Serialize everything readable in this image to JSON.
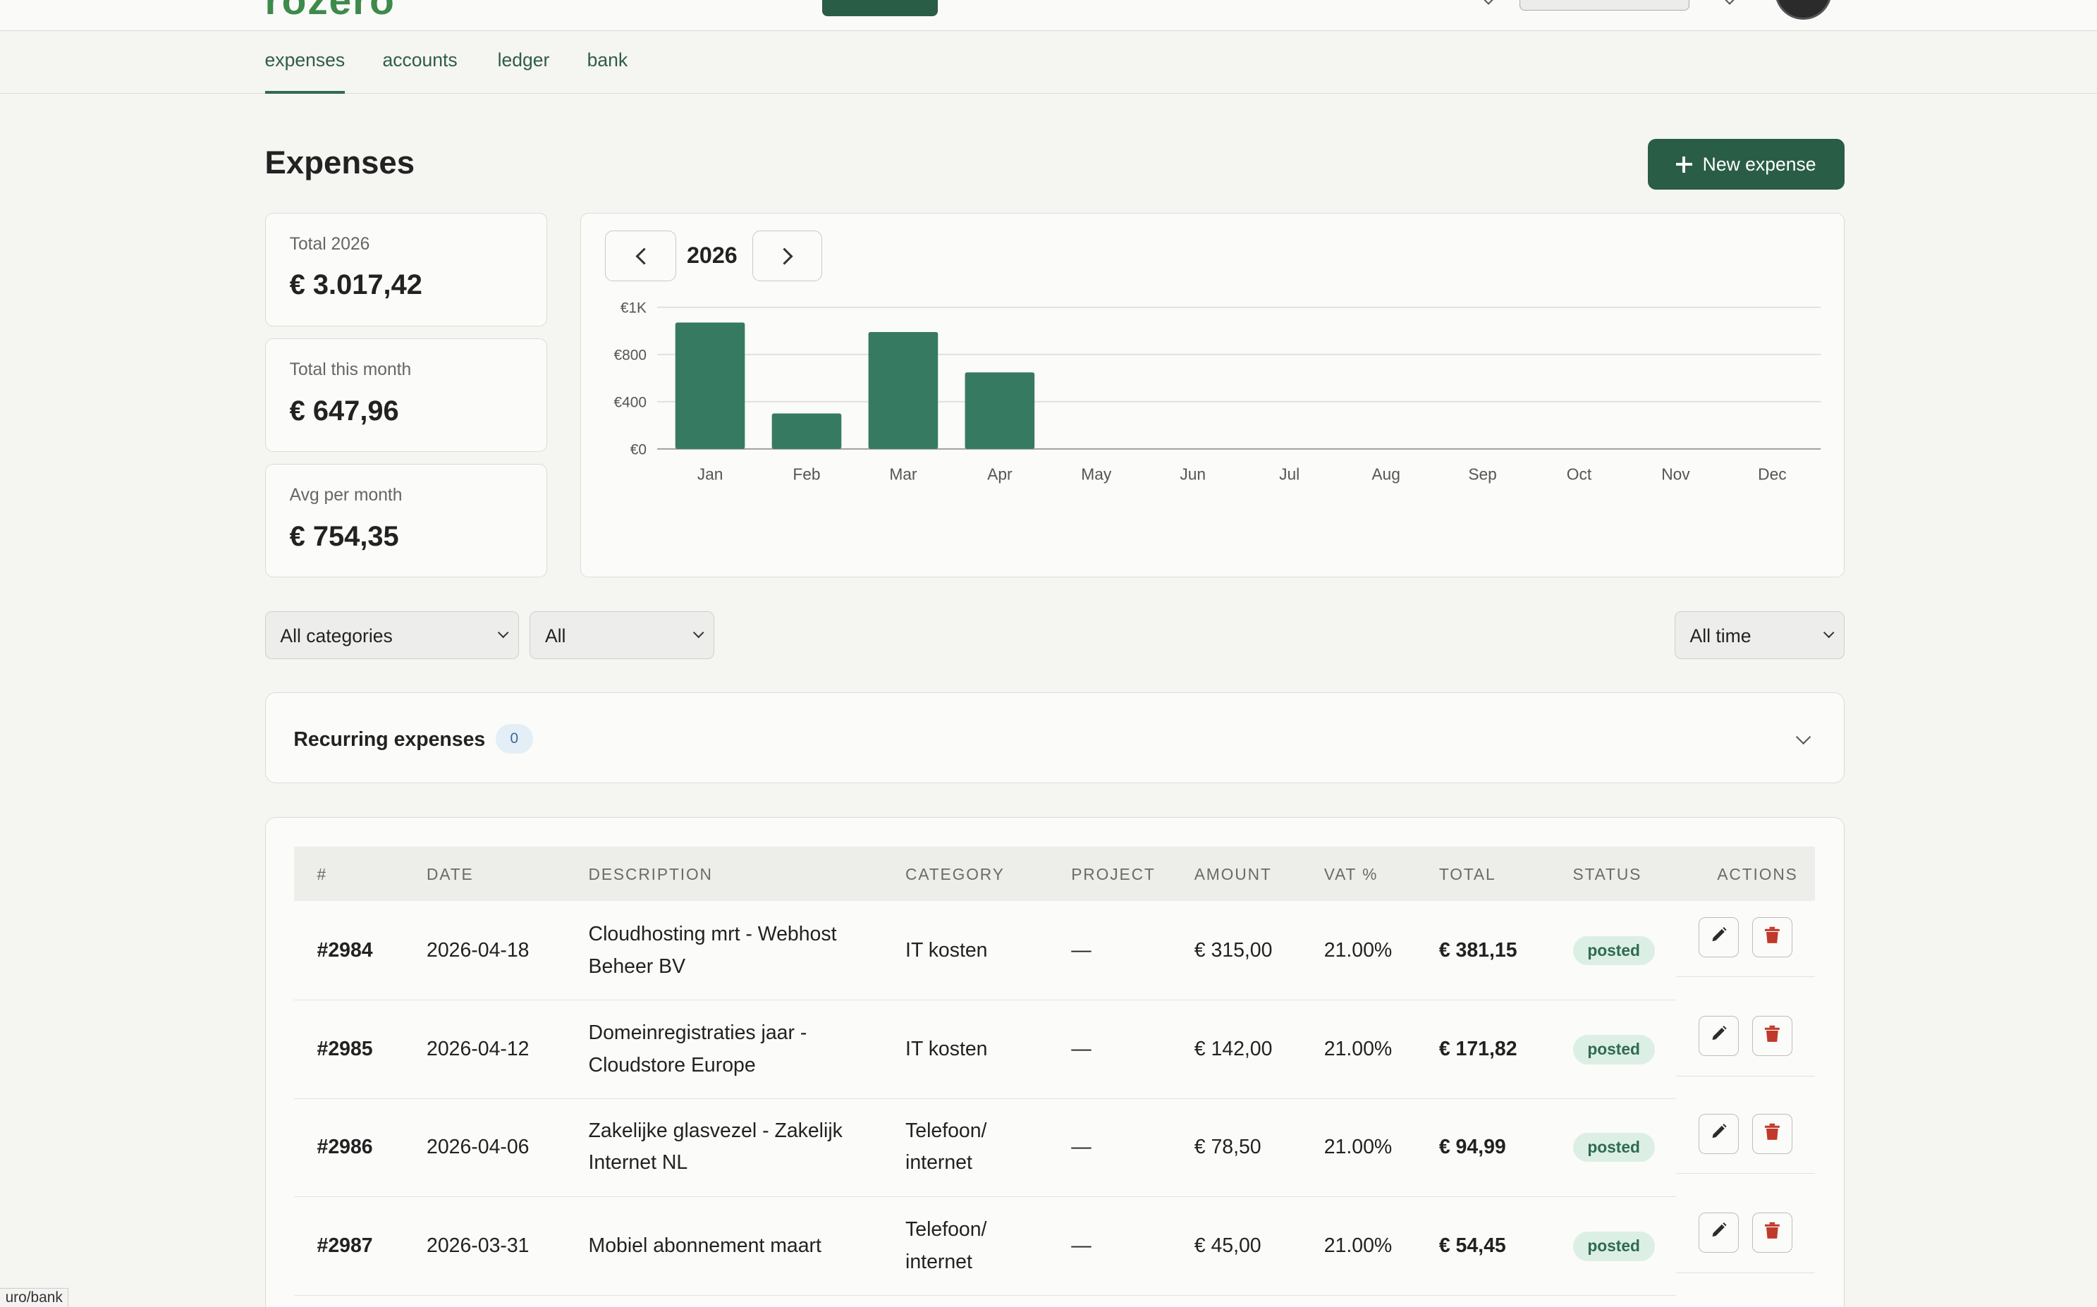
{
  "header": {
    "logo_text": "rozero"
  },
  "tabs": [
    {
      "label": "expenses",
      "active": true
    },
    {
      "label": "accounts",
      "active": false
    },
    {
      "label": "ledger",
      "active": false
    },
    {
      "label": "bank",
      "active": false
    }
  ],
  "page": {
    "title": "Expenses",
    "new_button_label": "New expense"
  },
  "stats": [
    {
      "label": "Total 2026",
      "value": "€ 3.017,42"
    },
    {
      "label": "Total this month",
      "value": "€ 647,96"
    },
    {
      "label": "Avg per month",
      "value": "€ 754,35"
    }
  ],
  "chart_nav": {
    "year": "2026"
  },
  "chart_data": {
    "type": "bar",
    "categories": [
      "Jan",
      "Feb",
      "Mar",
      "Apr",
      "May",
      "Jun",
      "Jul",
      "Aug",
      "Sep",
      "Oct",
      "Nov",
      "Dec"
    ],
    "values": [
      1070,
      300,
      990,
      647.96,
      0,
      0,
      0,
      0,
      0,
      0,
      0,
      0
    ],
    "y_ticks": [
      {
        "value": 0,
        "label": "€0"
      },
      {
        "value": 400,
        "label": "€400"
      },
      {
        "value": 800,
        "label": "€800"
      },
      {
        "value": 1200,
        "label": "€1K"
      }
    ],
    "ylim": [
      0,
      1200
    ],
    "grid": true,
    "bar_color": "#367b61"
  },
  "filters": {
    "category": "All categories",
    "type": "All",
    "period": "All time"
  },
  "recurring": {
    "title": "Recurring expenses",
    "count": "0"
  },
  "table": {
    "columns": [
      "#",
      "DATE",
      "DESCRIPTION",
      "CATEGORY",
      "PROJECT",
      "AMOUNT",
      "VAT %",
      "TOTAL",
      "STATUS",
      "ACTIONS"
    ],
    "rows": [
      {
        "id": "#2984",
        "date": "2026-04-18",
        "description": "Cloudhosting mrt - Webhost Beheer BV",
        "category": "IT kosten",
        "project": "—",
        "amount": "€ 315,00",
        "vat": "21.00%",
        "total": "€ 381,15",
        "status": "posted"
      },
      {
        "id": "#2985",
        "date": "2026-04-12",
        "description": "Domeinregistraties jaar - Cloudstore Europe",
        "category": "IT kosten",
        "project": "—",
        "amount": "€ 142,00",
        "vat": "21.00%",
        "total": "€ 171,82",
        "status": "posted"
      },
      {
        "id": "#2986",
        "date": "2026-04-06",
        "description": "Zakelijke glasvezel - Zakelijk Internet NL",
        "category": "Telefoon/ internet",
        "project": "—",
        "amount": "€ 78,50",
        "vat": "21.00%",
        "total": "€ 94,99",
        "status": "posted"
      },
      {
        "id": "#2987",
        "date": "2026-03-31",
        "description": "Mobiel abonnement maart",
        "category": "Telefoon/ internet",
        "project": "—",
        "amount": "€ 45,00",
        "vat": "21.00%",
        "total": "€ 54,45",
        "status": "posted"
      }
    ]
  },
  "status_bar": {
    "url": "uro/bank"
  },
  "colors": {
    "accent": "#2a5d46",
    "bar": "#367b61",
    "status_bg": "#dcefe5",
    "delete": "#c0392b"
  }
}
